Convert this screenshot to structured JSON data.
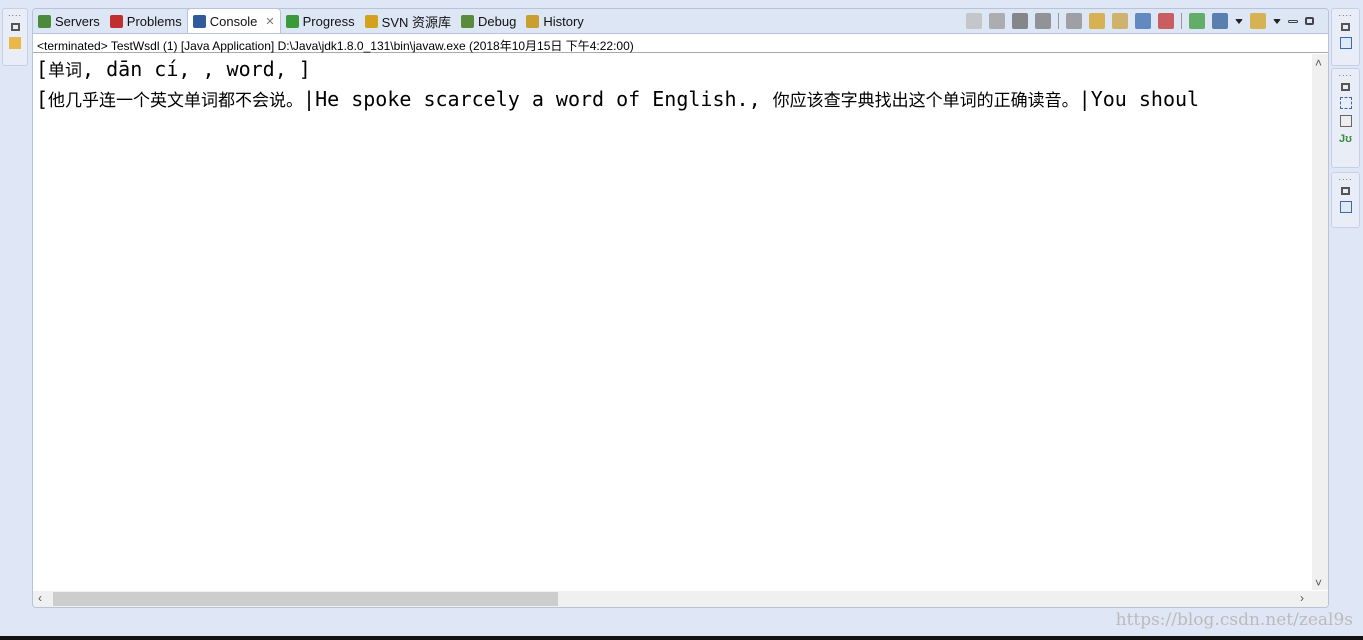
{
  "tabs": [
    {
      "label": "Servers",
      "icon": "servers-icon",
      "color": "#4a8a3a"
    },
    {
      "label": "Problems",
      "icon": "problems-icon",
      "color": "#c03030"
    },
    {
      "label": "Console",
      "icon": "console-icon",
      "color": "#2f5b9a",
      "active": true
    },
    {
      "label": "Progress",
      "icon": "progress-icon",
      "color": "#3a9a3a"
    },
    {
      "label": "SVN 资源库",
      "icon": "svn-icon",
      "color": "#d4a020"
    },
    {
      "label": "Debug",
      "icon": "debug-icon",
      "color": "#5a8a3a"
    },
    {
      "label": "History",
      "icon": "history-icon",
      "color": "#c8a030"
    }
  ],
  "info": "<terminated> TestWsdl (1) [Java Application] D:\\Java\\jdk1.8.0_131\\bin\\javaw.exe (2018年10月15日 下午4:22:00)",
  "console": {
    "line1": {
      "b": "[",
      "cn": "单词",
      "rest": ", dān cí, , word, ]"
    },
    "line2": {
      "b": "[",
      "cn1": "他几乎连一个英文单词都不会说。",
      "en1": "|He spoke scarcely a word of English., ",
      "cn2": "你应该查字典找出这个单词的正确读音。",
      "en2": "|You shoul"
    }
  },
  "toolbar_icons": [
    "sync-icon",
    "terminate-icon",
    "remove-icon",
    "remove-all-icon",
    "clear-console-icon",
    "scroll-lock-icon",
    "word-wrap-icon",
    "show-stdout-icon",
    "show-stderr-icon",
    "pin-console-icon",
    "display-console-icon",
    "display-dropdown-icon",
    "open-console-icon",
    "open-dropdown-icon",
    "minimize-icon",
    "maximize-icon"
  ],
  "watermark": "https://blog.csdn.net/zeal9s"
}
